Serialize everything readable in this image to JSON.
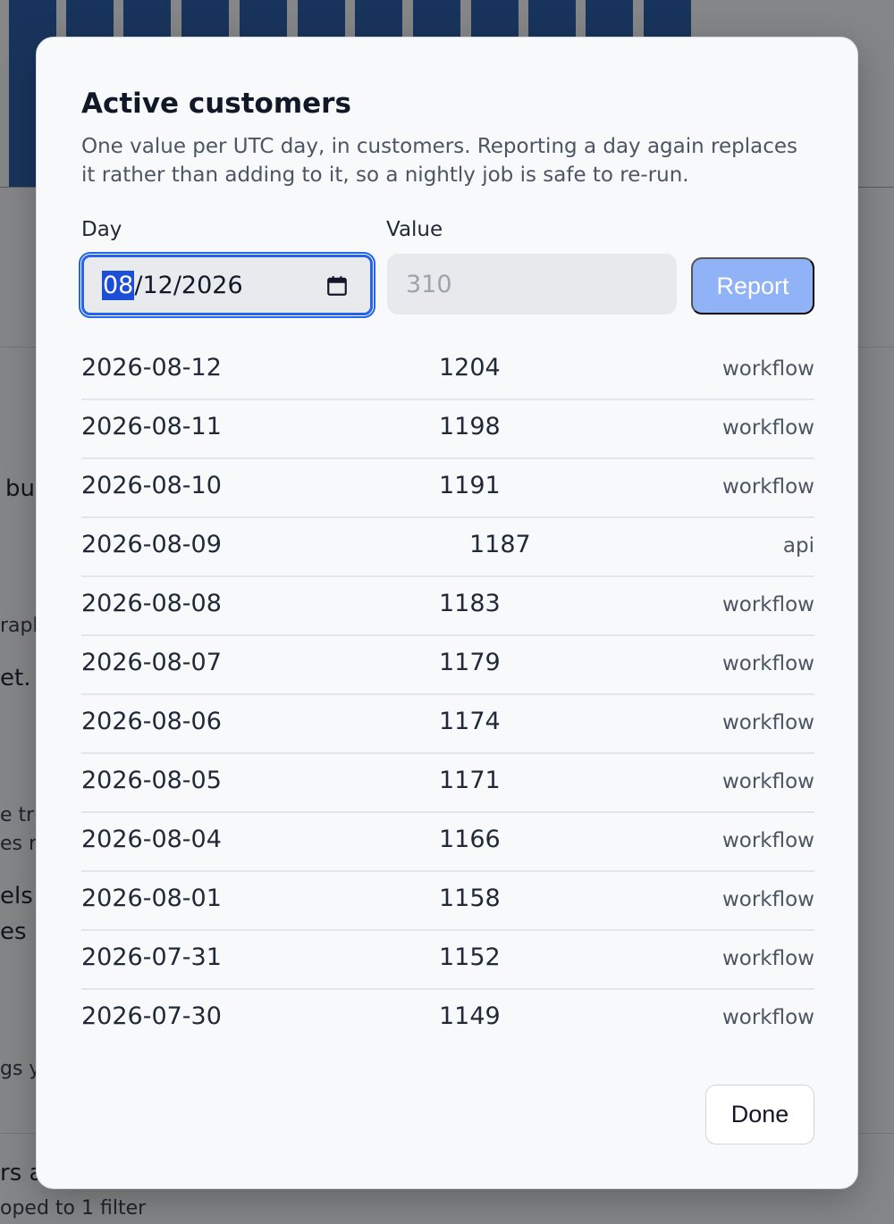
{
  "background": {
    "fragments": [
      "bu",
      "raph",
      "et. E",
      "e tr",
      "es r",
      "els y",
      "es .",
      "gs y",
      "rs a",
      "oped to 1 filter"
    ]
  },
  "modal": {
    "title": "Active customers",
    "description": "One value per UTC day, in customers. Reporting a day again replaces it rather than adding to it, so a nightly job is safe to re-run.",
    "day_label": "Day",
    "value_label": "Value",
    "day_input": {
      "month": "08",
      "rest": "/12/2026"
    },
    "value_placeholder": "310",
    "report_label": "Report",
    "done_label": "Done",
    "rows": [
      {
        "day": "2026-08-12",
        "value": "1204",
        "source": "workflow"
      },
      {
        "day": "2026-08-11",
        "value": "1198",
        "source": "workflow"
      },
      {
        "day": "2026-08-10",
        "value": "1191",
        "source": "workflow"
      },
      {
        "day": "2026-08-09",
        "value": "1187",
        "source": "api"
      },
      {
        "day": "2026-08-08",
        "value": "1183",
        "source": "workflow"
      },
      {
        "day": "2026-08-07",
        "value": "1179",
        "source": "workflow"
      },
      {
        "day": "2026-08-06",
        "value": "1174",
        "source": "workflow"
      },
      {
        "day": "2026-08-05",
        "value": "1171",
        "source": "workflow"
      },
      {
        "day": "2026-08-04",
        "value": "1166",
        "source": "workflow"
      },
      {
        "day": "2026-08-01",
        "value": "1158",
        "source": "workflow"
      },
      {
        "day": "2026-07-31",
        "value": "1152",
        "source": "workflow"
      },
      {
        "day": "2026-07-30",
        "value": "1149",
        "source": "workflow"
      }
    ]
  },
  "colors": {
    "accent": "#2563eb",
    "report_button": "#8fb3f6",
    "chart_bar": "#2f5fa8"
  }
}
